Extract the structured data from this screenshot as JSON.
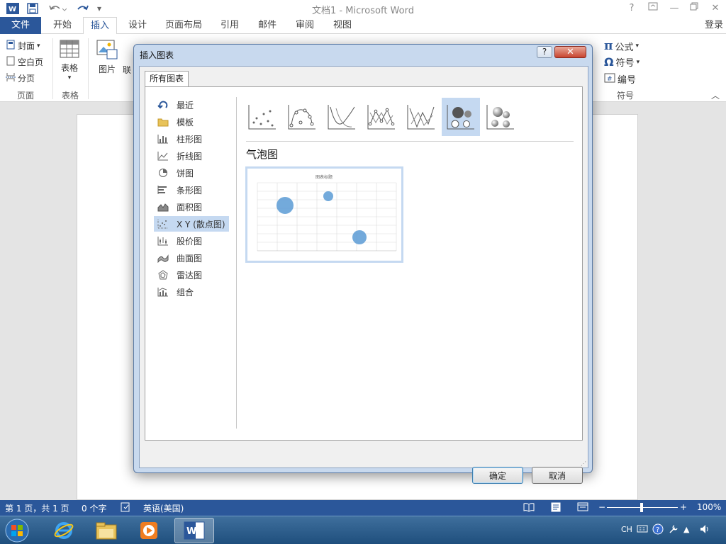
{
  "window": {
    "title": "文档1 - Microsoft Word"
  },
  "tabs": [
    {
      "label": "文件"
    },
    {
      "label": "开始"
    },
    {
      "label": "插入"
    },
    {
      "label": "设计"
    },
    {
      "label": "页面布局"
    },
    {
      "label": "引用"
    },
    {
      "label": "邮件"
    },
    {
      "label": "审阅"
    },
    {
      "label": "视图"
    }
  ],
  "account": {
    "login": "登录"
  },
  "ribbon": {
    "pages": {
      "cover": "封面",
      "blank": "空白页",
      "page_break": "分页",
      "group": "页面"
    },
    "tables": {
      "table": "表格",
      "group": "表格"
    },
    "illustrations": {
      "picture": "图片",
      "online": "联"
    },
    "symbols": {
      "equation": "公式",
      "symbol": "符号",
      "number": "编号",
      "group": "符号"
    }
  },
  "dialog": {
    "title": "插入图表",
    "help": "?",
    "tab": "所有图表",
    "categories": [
      {
        "label": "最近",
        "icon": "recent-icon"
      },
      {
        "label": "模板",
        "icon": "folder-icon"
      },
      {
        "label": "柱形图",
        "icon": "column-chart-icon"
      },
      {
        "label": "折线图",
        "icon": "line-chart-icon"
      },
      {
        "label": "饼图",
        "icon": "pie-chart-icon"
      },
      {
        "label": "条形图",
        "icon": "bar-chart-icon"
      },
      {
        "label": "面积图",
        "icon": "area-chart-icon"
      },
      {
        "label": "X Y (散点图)",
        "icon": "scatter-chart-icon",
        "selected": true
      },
      {
        "label": "股价图",
        "icon": "stock-chart-icon"
      },
      {
        "label": "曲面图",
        "icon": "surface-chart-icon"
      },
      {
        "label": "雷达图",
        "icon": "radar-chart-icon"
      },
      {
        "label": "组合",
        "icon": "combo-chart-icon"
      }
    ],
    "subtypes": [
      {
        "name": "scatter-icon"
      },
      {
        "name": "scatter-smooth-lines-markers-icon"
      },
      {
        "name": "scatter-smooth-lines-icon"
      },
      {
        "name": "scatter-straight-lines-markers-icon"
      },
      {
        "name": "scatter-straight-lines-icon"
      },
      {
        "name": "bubble-icon",
        "selected": true
      },
      {
        "name": "3d-bubble-icon"
      }
    ],
    "selected_name": "气泡图",
    "preview_title": "图表标题",
    "ok": "确定",
    "cancel": "取消"
  },
  "status": {
    "page": "第 1 页，共 1 页",
    "words": "0 个字",
    "language": "英语(美国)",
    "zoom": "100%"
  },
  "taskbar": {
    "ime": "CH"
  },
  "colors": {
    "accent": "#2b579a",
    "bubble": "#5b9bd5",
    "selection": "#c5d9f1"
  }
}
